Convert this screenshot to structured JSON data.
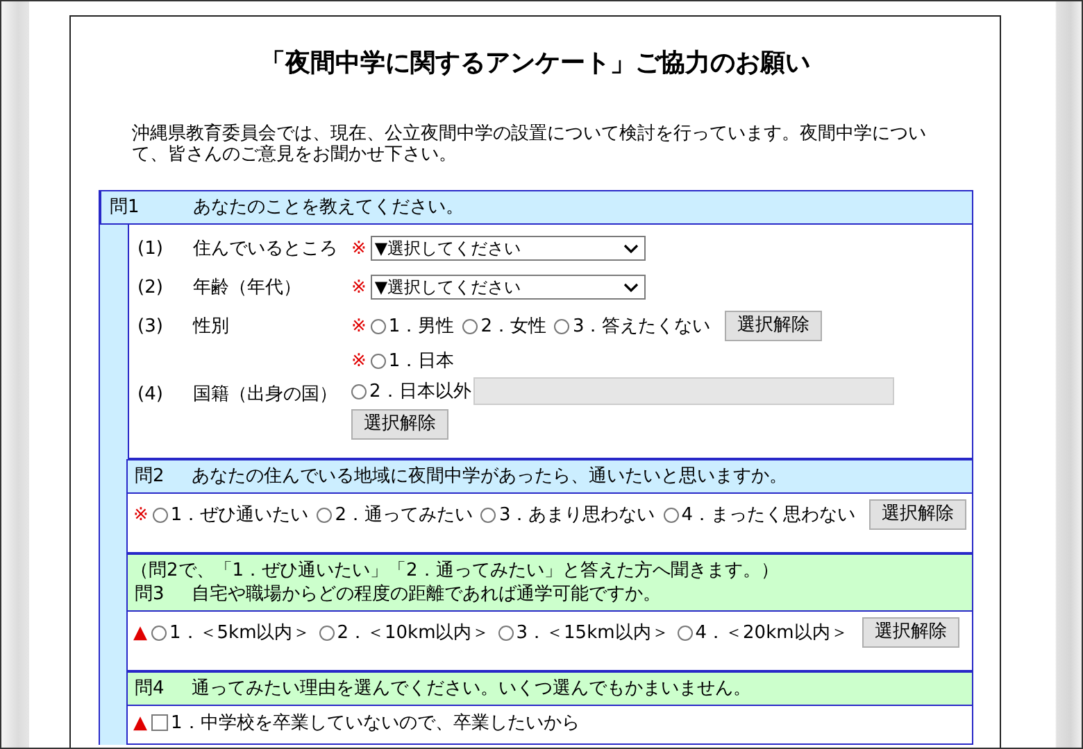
{
  "title": "「夜間中学に関するアンケート」ご協力のお願い",
  "intro": "沖縄県教育委員会では、現在、公立夜間中学の設置について検討を行っています。夜間中学について、皆さんのご意見をお聞かせ下さい。",
  "questions": [
    {
      "number": "問1",
      "text": "あなたのことを教えてください。",
      "color": "#cceeff",
      "rows": [
        {
          "kind": "select",
          "number": "(1)",
          "label": "住んでいるところ",
          "mark": "※",
          "value": "▼選択してください"
        },
        {
          "kind": "select",
          "number": "(2)",
          "label": "年齢（年代）",
          "mark": "※",
          "value": "▼選択してください"
        },
        {
          "kind": "radio",
          "number": "(3)",
          "label": "性別",
          "mark": "※",
          "options": [
            {
              "label": "1．男性",
              "selected": false
            },
            {
              "label": "2．女性",
              "selected": false
            },
            {
              "label": "3．答えたくない",
              "selected": false
            }
          ],
          "button": "選択解除"
        },
        {
          "kind": "radio_stack",
          "number": "(4)",
          "label": "国籍（出身の国）",
          "mark": "※",
          "options": [
            {
              "label": "1．日本",
              "selected": false
            },
            {
              "label": "2．日本以外",
              "selected": false,
              "field": {
                "disabled": true
              }
            }
          ],
          "button": "選択解除"
        }
      ]
    },
    {
      "number": "問2",
      "text": "あなたの住んでいる地域に夜間中学があったら、通いたいと思いますか。",
      "color": "#cceeff",
      "rows": [
        {
          "kind": "radio",
          "mark": "※",
          "options": [
            {
              "label": "1．ぜひ通いたい",
              "selected": false
            },
            {
              "label": "2．通ってみたい",
              "selected": false
            },
            {
              "label": "3．あまり思わない",
              "selected": false
            },
            {
              "label": "4．まったく思わない",
              "selected": false
            }
          ],
          "button": "選択解除"
        }
      ]
    },
    {
      "number": "問3",
      "note": "（問2で、「1．ぜひ通いたい」「2．通ってみたい」と答えた方へ聞きます。）",
      "text": "自宅や職場からどの程度の距離であれば通学可能ですか。",
      "color": "#ccffcc",
      "rows": [
        {
          "kind": "radio",
          "mark": "▲",
          "options": [
            {
              "label": "1．＜5km以内＞",
              "selected": false
            },
            {
              "label": "2．＜10km以内＞",
              "selected": false
            },
            {
              "label": "3．＜15km以内＞",
              "selected": false
            },
            {
              "label": "4．＜20km以内＞",
              "selected": false
            }
          ],
          "button": "選択解除"
        }
      ]
    },
    {
      "number": "問4",
      "text": "通ってみたい理由を選んでください。いくつ選んでもかまいません。",
      "color": "#ccffcc",
      "rows": [
        {
          "kind": "checkbox",
          "mark": "▲",
          "options": [
            {
              "label": "1．中学校を卒業していないので、卒業したいから",
              "checked": false
            }
          ]
        }
      ]
    }
  ]
}
